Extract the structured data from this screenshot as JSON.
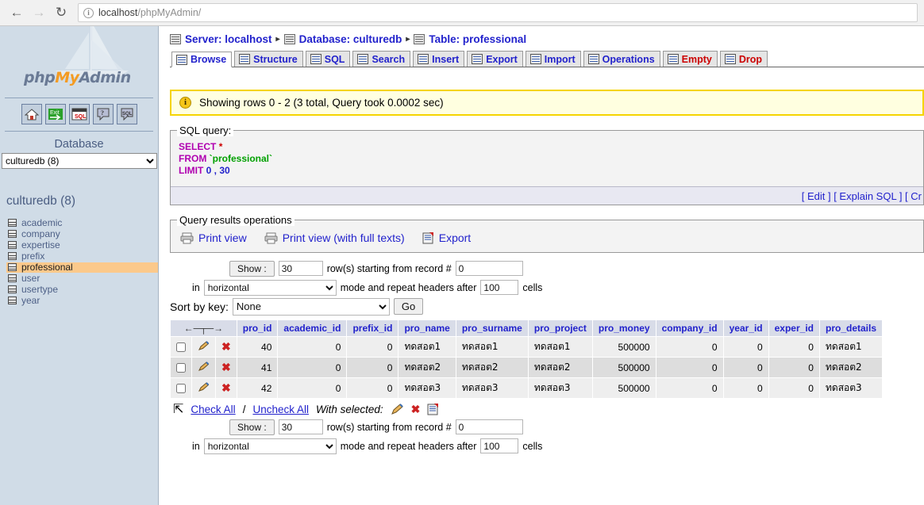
{
  "browser": {
    "back_icon": "back-arrow-icon",
    "forward_icon": "forward-arrow-icon",
    "reload_icon": "reload-icon",
    "info_icon": "info-circle-icon",
    "url_host": "localhost",
    "url_path": "/phpMyAdmin/"
  },
  "sidebar": {
    "logo_php": "php",
    "logo_my": "My",
    "logo_admin": "Admin",
    "icons": [
      {
        "name": "home-icon",
        "label": "Home"
      },
      {
        "name": "exit-icon",
        "label": "Exit"
      },
      {
        "name": "sql-icon",
        "label": "SQL"
      },
      {
        "name": "docs-icon",
        "label": "Documentation"
      },
      {
        "name": "sql-help-icon",
        "label": "SQL Help"
      }
    ],
    "database_heading": "Database",
    "database_select_value": "culturedb (8)",
    "database_options": [
      "culturedb (8)"
    ],
    "db_name": "culturedb (8)",
    "tables": [
      {
        "label": "academic",
        "active": false
      },
      {
        "label": "company",
        "active": false
      },
      {
        "label": "expertise",
        "active": false
      },
      {
        "label": "prefix",
        "active": false
      },
      {
        "label": "professional",
        "active": true
      },
      {
        "label": "user",
        "active": false
      },
      {
        "label": "usertype",
        "active": false
      },
      {
        "label": "year",
        "active": false
      }
    ]
  },
  "breadcrumb": {
    "server": "Server: localhost",
    "database": "Database: culturedb",
    "table": "Table: professional",
    "separator": "▸"
  },
  "tabs": [
    {
      "label": "Browse",
      "icon": "browse-icon",
      "active": true,
      "danger": false
    },
    {
      "label": "Structure",
      "icon": "structure-icon",
      "active": false,
      "danger": false
    },
    {
      "label": "SQL",
      "icon": "sql-icon",
      "active": false,
      "danger": false
    },
    {
      "label": "Search",
      "icon": "search-icon",
      "active": false,
      "danger": false
    },
    {
      "label": "Insert",
      "icon": "insert-icon",
      "active": false,
      "danger": false
    },
    {
      "label": "Export",
      "icon": "export-icon",
      "active": false,
      "danger": false
    },
    {
      "label": "Import",
      "icon": "import-icon",
      "active": false,
      "danger": false
    },
    {
      "label": "Operations",
      "icon": "operations-icon",
      "active": false,
      "danger": false
    },
    {
      "label": "Empty",
      "icon": "empty-icon",
      "active": false,
      "danger": true
    },
    {
      "label": "Drop",
      "icon": "drop-icon",
      "active": false,
      "danger": true
    }
  ],
  "status_message": "Showing rows 0 - 2 (3 total, Query took 0.0002 sec)",
  "sql_query": {
    "legend": "SQL query:",
    "line1_keyword": "SELECT",
    "line1_star": "*",
    "line2_keyword": "FROM",
    "line2_table": "`professional`",
    "line3_keyword": "LIMIT",
    "line3_args": "0 , 30",
    "links": "[ Edit ] [ Explain SQL ] [ Cr"
  },
  "query_results_operations": {
    "legend": "Query results operations",
    "print_view": "Print view",
    "print_view_full": "Print view (with full texts)",
    "export": "Export"
  },
  "controls_top": {
    "show_button": "Show :",
    "rows_value": "30",
    "rows_label": "row(s) starting from record #",
    "record_value": "0",
    "in_label": "in",
    "mode_value": "horizontal",
    "mode_options": [
      "horizontal"
    ],
    "mode_label": "mode and repeat headers after",
    "headers_value": "100",
    "cells_label": "cells",
    "sort_label": "Sort by key:",
    "sort_value": "None",
    "sort_options": [
      "None"
    ],
    "go_button": "Go"
  },
  "controls_bottom": {
    "show_button": "Show :",
    "rows_value": "30",
    "rows_label": "row(s) starting from record #",
    "record_value": "0",
    "in_label": "in",
    "mode_value": "horizontal",
    "mode_options": [
      "horizontal"
    ],
    "mode_label": "mode and repeat headers after",
    "headers_value": "100",
    "cells_label": "cells"
  },
  "results_table": {
    "nav_header": "←─┬─→",
    "columns": [
      "pro_id",
      "academic_id",
      "prefix_id",
      "pro_name",
      "pro_surname",
      "pro_project",
      "pro_money",
      "company_id",
      "year_id",
      "exper_id",
      "pro_details"
    ],
    "rows": [
      {
        "pro_id": "40",
        "academic_id": "0",
        "prefix_id": "0",
        "pro_name": "ทดสอต1",
        "pro_surname": "ทดสอต1",
        "pro_project": "ทดสอต1",
        "pro_money": "500000",
        "company_id": "0",
        "year_id": "0",
        "exper_id": "0",
        "pro_details": "ทดสอต1"
      },
      {
        "pro_id": "41",
        "academic_id": "0",
        "prefix_id": "0",
        "pro_name": "ทดสอต2",
        "pro_surname": "ทดสอต2",
        "pro_project": "ทดสอต2",
        "pro_money": "500000",
        "company_id": "0",
        "year_id": "0",
        "exper_id": "0",
        "pro_details": "ทดสอต2"
      },
      {
        "pro_id": "42",
        "academic_id": "0",
        "prefix_id": "0",
        "pro_name": "ทดสอต3",
        "pro_surname": "ทดสอต3",
        "pro_project": "ทดสอต3",
        "pro_money": "500000",
        "company_id": "0",
        "year_id": "0",
        "exper_id": "0",
        "pro_details": "ทดสอต3"
      }
    ]
  },
  "check_all_row": {
    "check_all": "Check All",
    "slash": "/",
    "uncheck_all": "Uncheck All",
    "with_selected": "With selected:",
    "edit_icon": "pencil-icon",
    "delete_icon": "delete-x-icon",
    "export_icon": "export-icon"
  },
  "colors": {
    "sidebar_bg": "#d0dce7",
    "accent_link": "#2222cc",
    "danger": "#cc0000",
    "active_table": "#fbc98b",
    "banner_bg": "#ffffe0",
    "banner_border": "#f5d400",
    "th_bg": "#d8dce8",
    "row_odd": "#eeeeee",
    "row_even": "#dddddd"
  }
}
